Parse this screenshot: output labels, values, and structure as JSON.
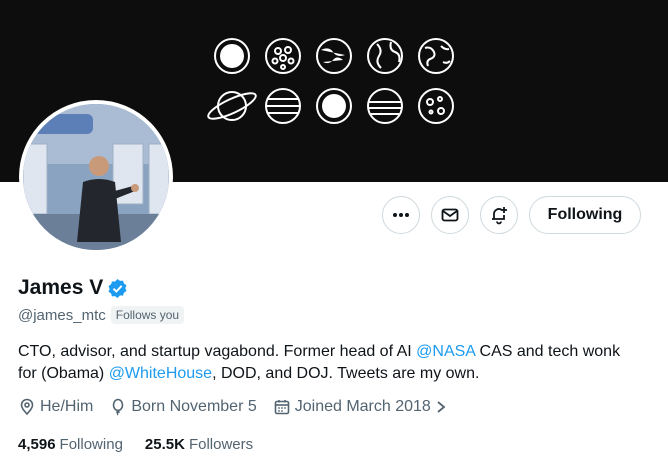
{
  "profile": {
    "display_name": "James V",
    "handle": "@james_mtc",
    "follows_you_badge": "Follows you"
  },
  "actions": {
    "follow_label": "Following",
    "more_icon": "more-horizontal-icon",
    "message_icon": "envelope-icon",
    "notify_icon": "bell-plus-icon"
  },
  "bio": {
    "part1": "CTO, advisor, and startup vagabond. Former head of AI ",
    "mention1": "@NASA",
    "part2": " CAS and tech wonk for (Obama) ",
    "mention2": "@WhiteHouse",
    "part3": ", DOD, and DOJ. Tweets are my own."
  },
  "meta": {
    "pronouns": "He/Him",
    "birthday": "Born November 5",
    "joined": "Joined March 2018"
  },
  "stats": {
    "following_count": "4,596",
    "following_label": "Following",
    "followers_count": "25.5K",
    "followers_label": "Followers"
  },
  "colors": {
    "accent": "#1d9bf0",
    "banner": "#0d0d0d",
    "secondary_text": "#536471"
  }
}
